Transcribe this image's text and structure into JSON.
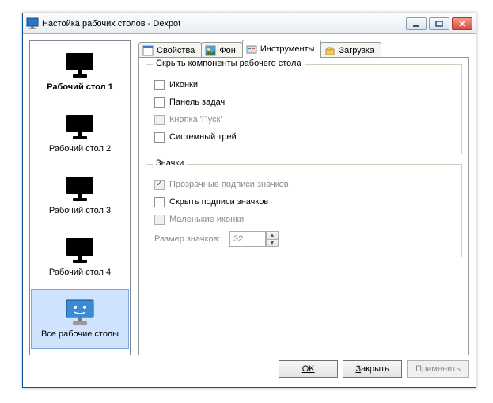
{
  "window": {
    "title": "Настойка рабочих столов - Dexpot"
  },
  "sidebar": {
    "items": [
      {
        "label": "Рабочий стол 1"
      },
      {
        "label": "Рабочий стол 2"
      },
      {
        "label": "Рабочий стол 3"
      },
      {
        "label": "Рабочий стол 4"
      },
      {
        "label": "Все рабочие столы"
      }
    ]
  },
  "tabs": {
    "props": "Свойства",
    "bg": "Фон",
    "tools": "Инструменты",
    "load": "Загрузка"
  },
  "group_hide": {
    "title": "Скрыть компоненты рабочего стола",
    "icons": "Иконки",
    "taskbar": "Панель задач",
    "start": "Кнопка 'Пуск'",
    "tray": "Системный трей"
  },
  "group_icons": {
    "title": "Значки",
    "transparent": "Прозрачные подписи значков",
    "hide_labels": "Скрыть подписи значков",
    "small": "Маленькие иконки",
    "size_label": "Размер значков:",
    "size_value": "32"
  },
  "buttons": {
    "ok": "OK",
    "close": "Закрыть",
    "apply": "Применить"
  }
}
